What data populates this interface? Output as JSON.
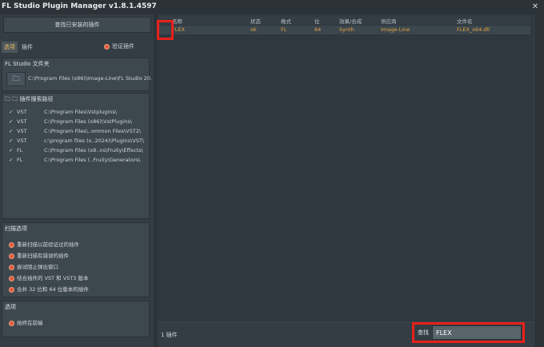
{
  "window": {
    "title": "FL Studio Plugin Manager v1.8.1.4597",
    "close_glyph": "✕"
  },
  "left": {
    "scan_button": "查找已安装的插件",
    "tabs": [
      "选项",
      "插件"
    ],
    "verify_label": "验证插件",
    "fl_folder": {
      "title": "FL Studio 文件夹",
      "path": "C:\\Program Files (x86)\\Image-Line\\FL Studio 20."
    },
    "search_paths": {
      "title": "插件搜索路径",
      "rows": [
        {
          "type": "VST",
          "path": "C:\\Program Files\\Vstplugins\\"
        },
        {
          "type": "VST",
          "path": "C:\\Program Files (x86)\\VstPlugins\\"
        },
        {
          "type": "VST",
          "path": "C:\\Program Files\\..ommon Files\\VST2\\"
        },
        {
          "type": "VST",
          "path": "c:\\program files (x..2024)\\Plugins\\VST\\"
        },
        {
          "type": "FL",
          "path": "C:\\Program Files (x8..ns\\Fruity\\Effects\\"
        },
        {
          "type": "FL",
          "path": "C:\\Program Files (..Fruity\\Generators\\"
        }
      ]
    },
    "scan_options": {
      "title": "扫描选项",
      "items": [
        "重新扫描以前验证过的插件",
        "重新扫描有错误的插件",
        "尝试阻止弹出窗口",
        "结合插件的 VST 和 VST3 版本",
        "合并 32 位和 64 位版本的插件"
      ]
    },
    "options": {
      "title": "选项",
      "items": [
        "始终在前端"
      ]
    }
  },
  "table": {
    "columns": [
      "名称",
      "状态",
      "格式",
      "位",
      "效果/合成",
      "供应商",
      "文件名"
    ],
    "rows": [
      {
        "name": "FLEX",
        "status": "ok",
        "format": "FL",
        "bits": "64",
        "kind": "Synth",
        "vendor": "Image-Line",
        "file": "FLEX_x64.dll"
      }
    ]
  },
  "status": {
    "count": "1 插件",
    "search_label": "查找",
    "search_value": "FLEX"
  },
  "colors": {
    "accent_orange": "#e8a640",
    "highlight_red": "#e8201a",
    "radio_red": "#e05a3a"
  }
}
